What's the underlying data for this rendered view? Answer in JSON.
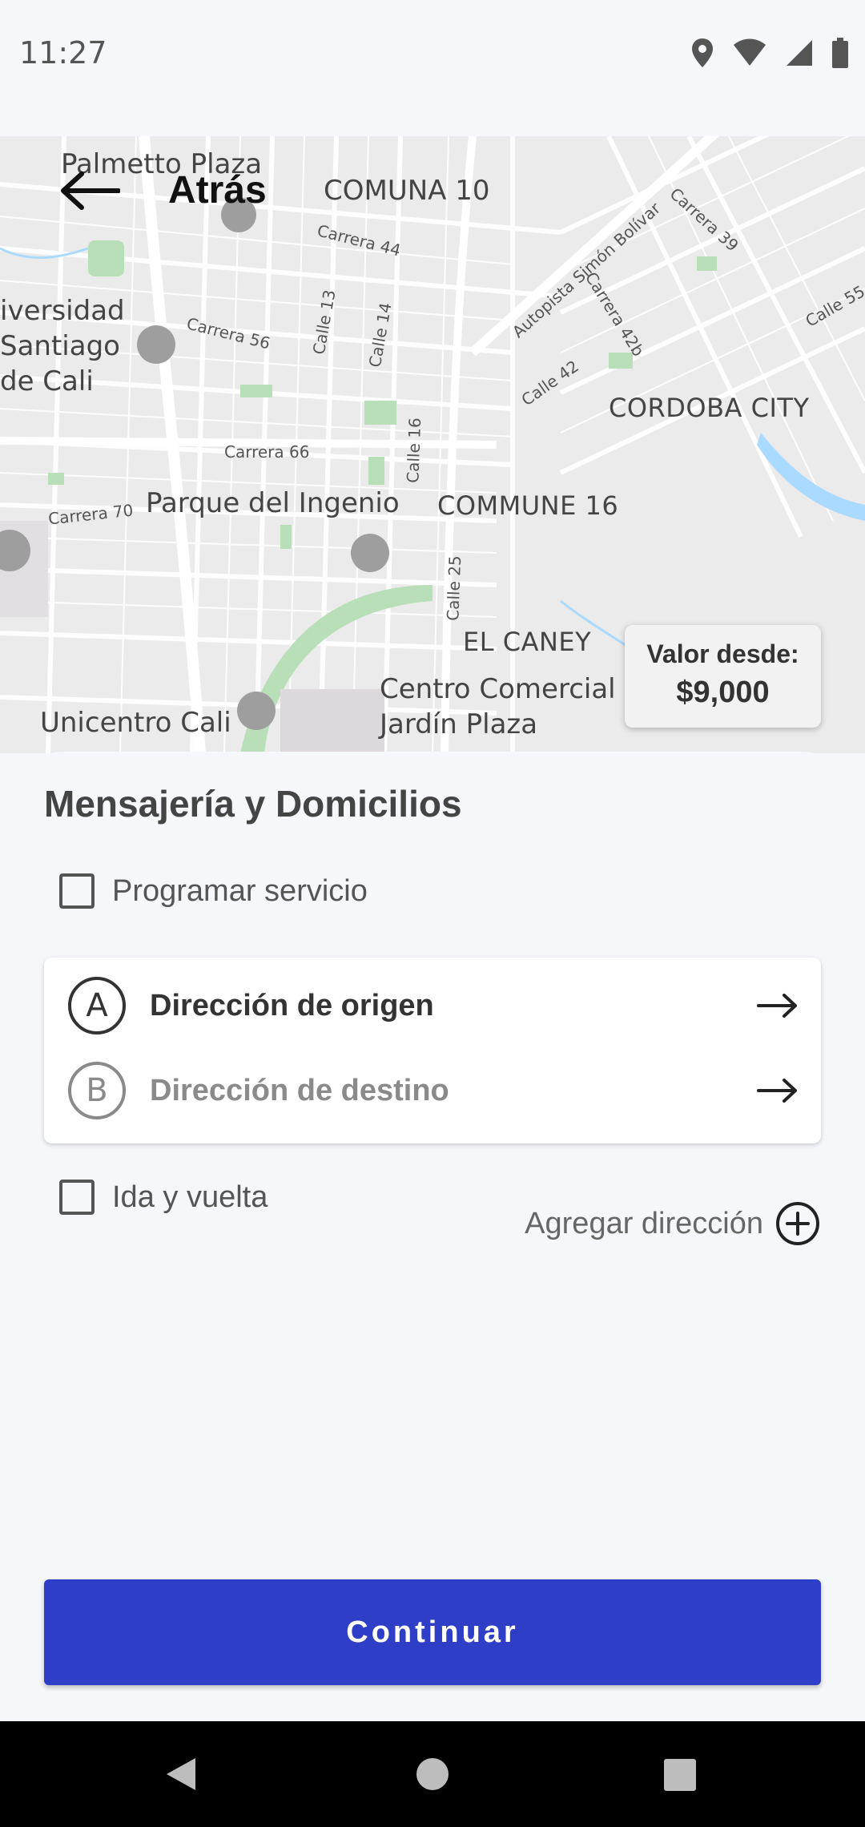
{
  "status_bar": {
    "time": "11:27"
  },
  "header": {
    "back_label": "Atrás"
  },
  "map": {
    "labels": {
      "palmetto": "Palmetto Plaza",
      "comuna10": "COMUNA 10",
      "universidad_1": "iversidad",
      "universidad_2": "Santiago",
      "universidad_3": "de Cali",
      "cordoba": "CORDOBA CITY",
      "parque": "Parque del Ingenio",
      "commune16": "COMMUNE 16",
      "el_caney": "EL CANEY",
      "centro_1": "Centro Comercial",
      "centro_2": "Jardín Plaza",
      "unicentro": "Unicentro Cali",
      "carrera44": "Carrera 44",
      "carrera56": "Carrera 56",
      "carrera66": "Carrera 66",
      "carrera70": "Carrera 70",
      "calle13": "Calle 13",
      "calle14": "Calle 14",
      "calle16": "Calle 16",
      "calle25": "Calle 25",
      "calle42": "Calle 42",
      "calle55": "Calle 55",
      "carrera39": "Carrera 39",
      "carrera42b": "Carrera 42b",
      "autopista": "Autopista Simón Bolívar"
    }
  },
  "price": {
    "label": "Valor desde:",
    "value": "$9,000"
  },
  "sheet": {
    "title": "Mensajería y Domicilios",
    "schedule_label": "Programar servicio",
    "origin": {
      "letter": "A",
      "label": "Dirección de origen"
    },
    "destination": {
      "letter": "B",
      "label": "Dirección de destino"
    },
    "round_trip_label": "Ida y vuelta",
    "add_address_label": "Agregar dirección",
    "continue_label": "Continuar"
  },
  "colors": {
    "primary": "#2f3ec7",
    "background": "#f6f7fb",
    "map": "#ececec"
  }
}
